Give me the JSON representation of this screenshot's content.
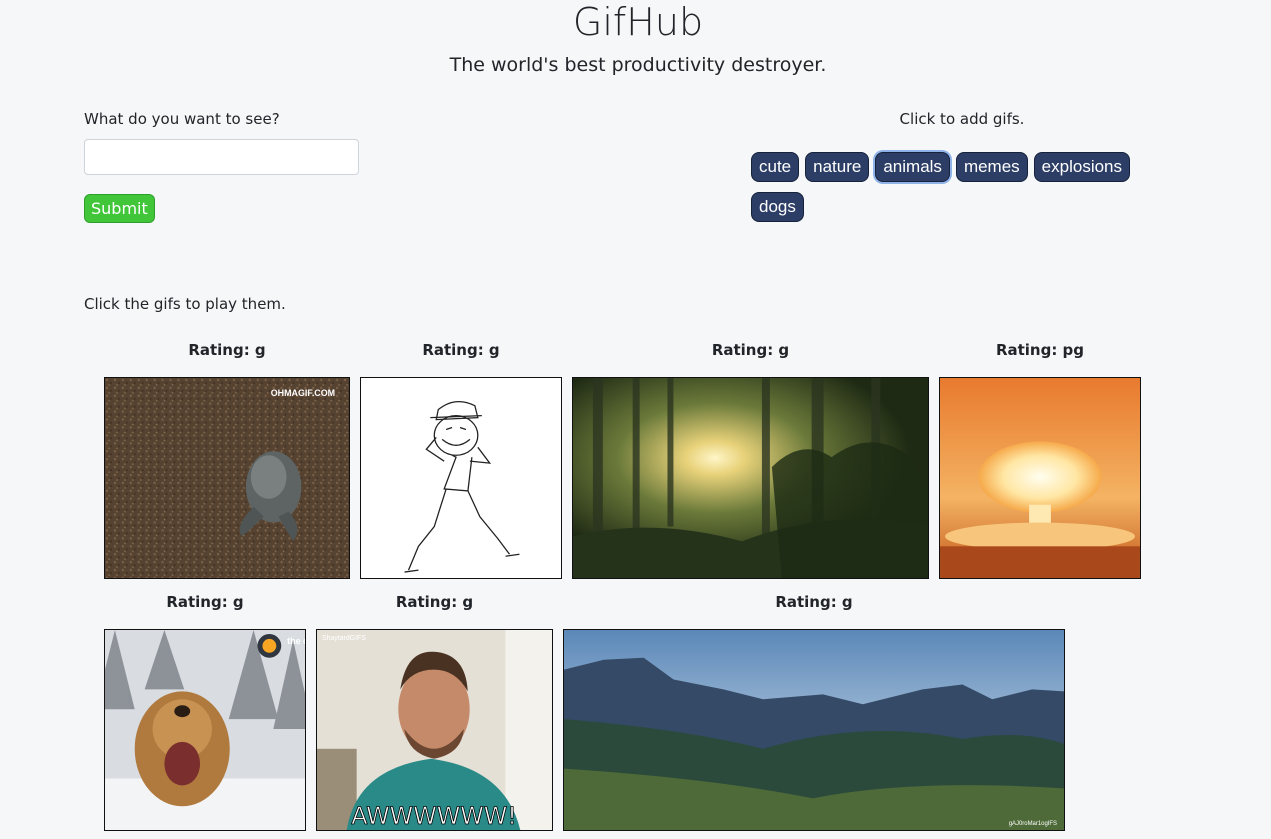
{
  "header": {
    "title": "GifHub",
    "subtitle": "The world's best productivity destroyer."
  },
  "search": {
    "label": "What do you want to see?",
    "value": "",
    "placeholder": "",
    "submit_label": "Submit"
  },
  "topics": {
    "label": "Click to add gifs.",
    "buttons": [
      "cute",
      "nature",
      "animals",
      "memes",
      "explosions",
      "dogs"
    ],
    "active": "animals"
  },
  "gifs": {
    "label": "Click the gifs to play them.",
    "items": [
      {
        "rating": "Rating: g",
        "watermark": "OHMAGIF.COM",
        "subject": "octopus-on-sand"
      },
      {
        "rating": "Rating: g",
        "subject": "trollface-dancing-sketch"
      },
      {
        "rating": "Rating: g",
        "subject": "forest-sunbeams"
      },
      {
        "rating": "Rating: pg",
        "subject": "mushroom-cloud-explosion"
      },
      {
        "rating": "Rating: g",
        "watermark": "the dodo",
        "subject": "golden-retriever-in-snow"
      },
      {
        "rating": "Rating: g",
        "watermark": "ShaytardGIFS",
        "caption": "AWWWWWW!",
        "subject": "man-reaction"
      },
      {
        "rating": "Rating: g",
        "watermark": "gAJ0roMar1ogIFS",
        "subject": "mountain-landscape"
      }
    ]
  },
  "colors": {
    "background": "#f6f7f9",
    "submit": "#41c63a",
    "topic_button": "#2c3e66"
  }
}
